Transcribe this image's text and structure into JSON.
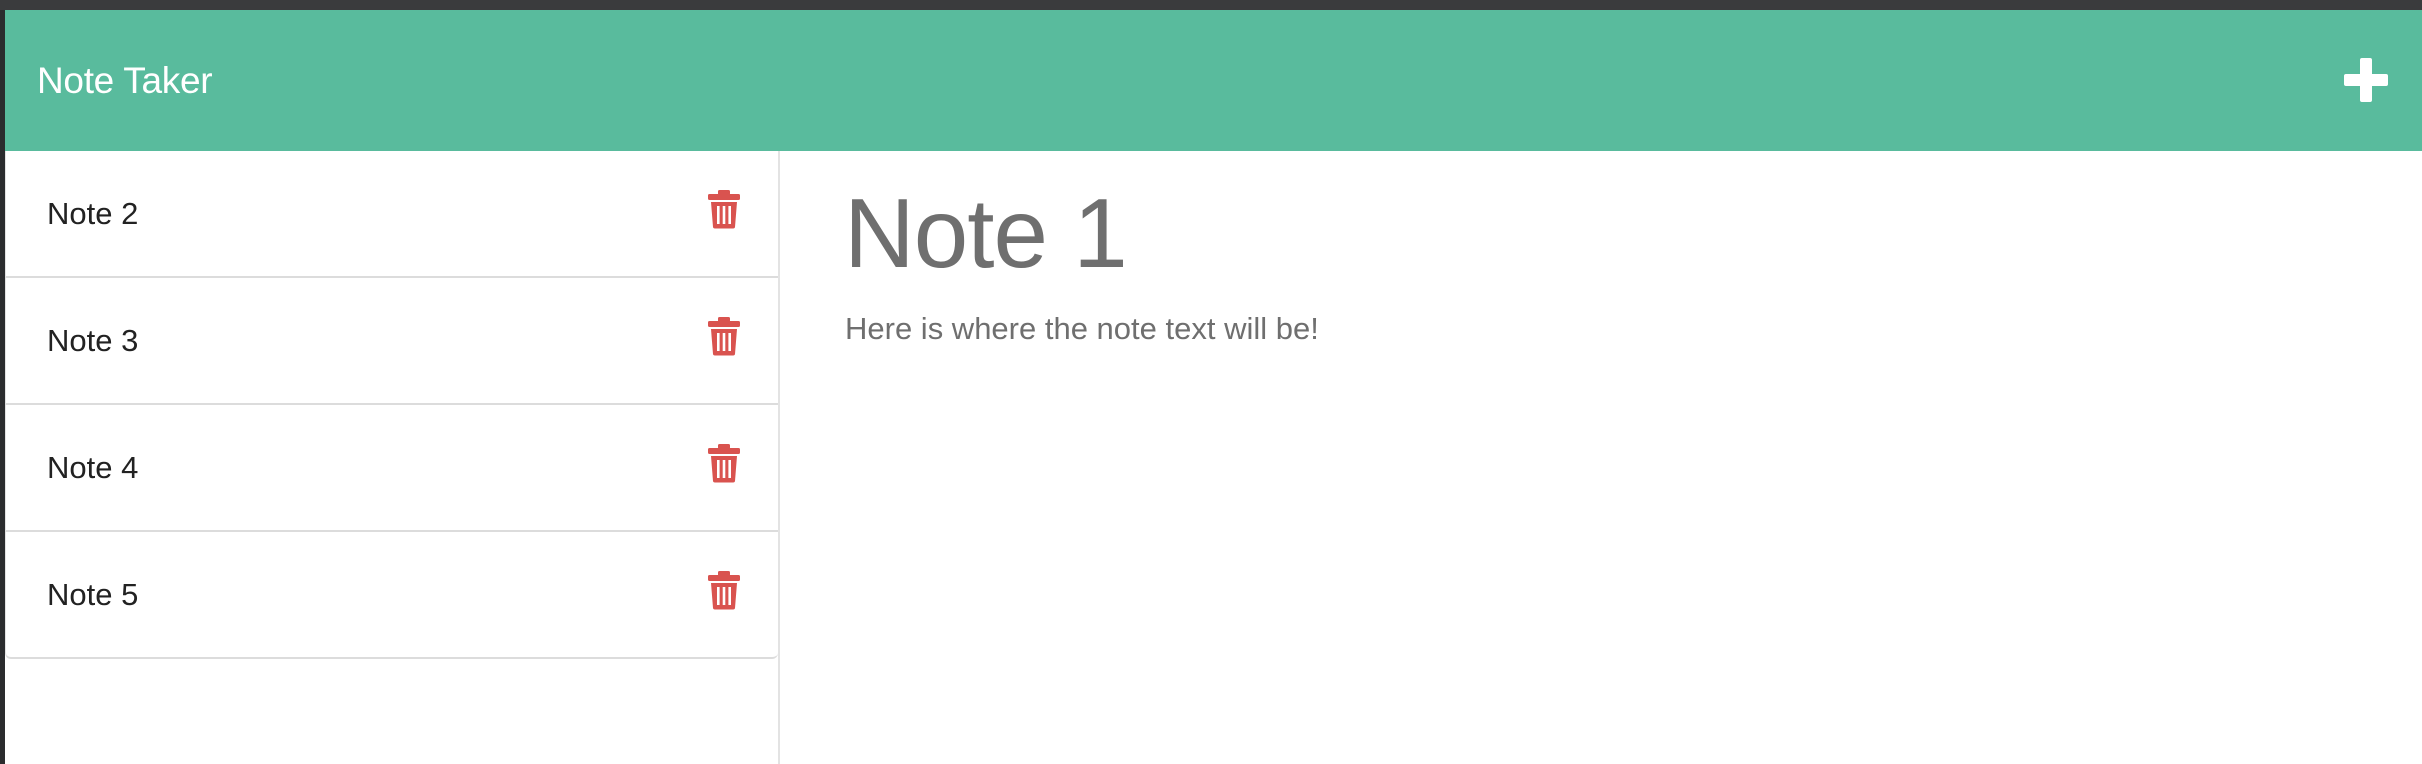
{
  "colors": {
    "navbar": "#59bb9d",
    "delete_icon": "#d9534f",
    "text_muted": "#6f6f6f"
  },
  "navbar": {
    "title": "Note Taker",
    "add_icon": "plus-icon"
  },
  "sidebar": {
    "notes": [
      {
        "label": "Note 2",
        "icon": "trash-icon"
      },
      {
        "label": "Note 3",
        "icon": "trash-icon"
      },
      {
        "label": "Note 4",
        "icon": "trash-icon"
      },
      {
        "label": "Note 5",
        "icon": "trash-icon"
      }
    ]
  },
  "editor": {
    "title": "Note 1",
    "text": "Here is where the note text will be!"
  }
}
